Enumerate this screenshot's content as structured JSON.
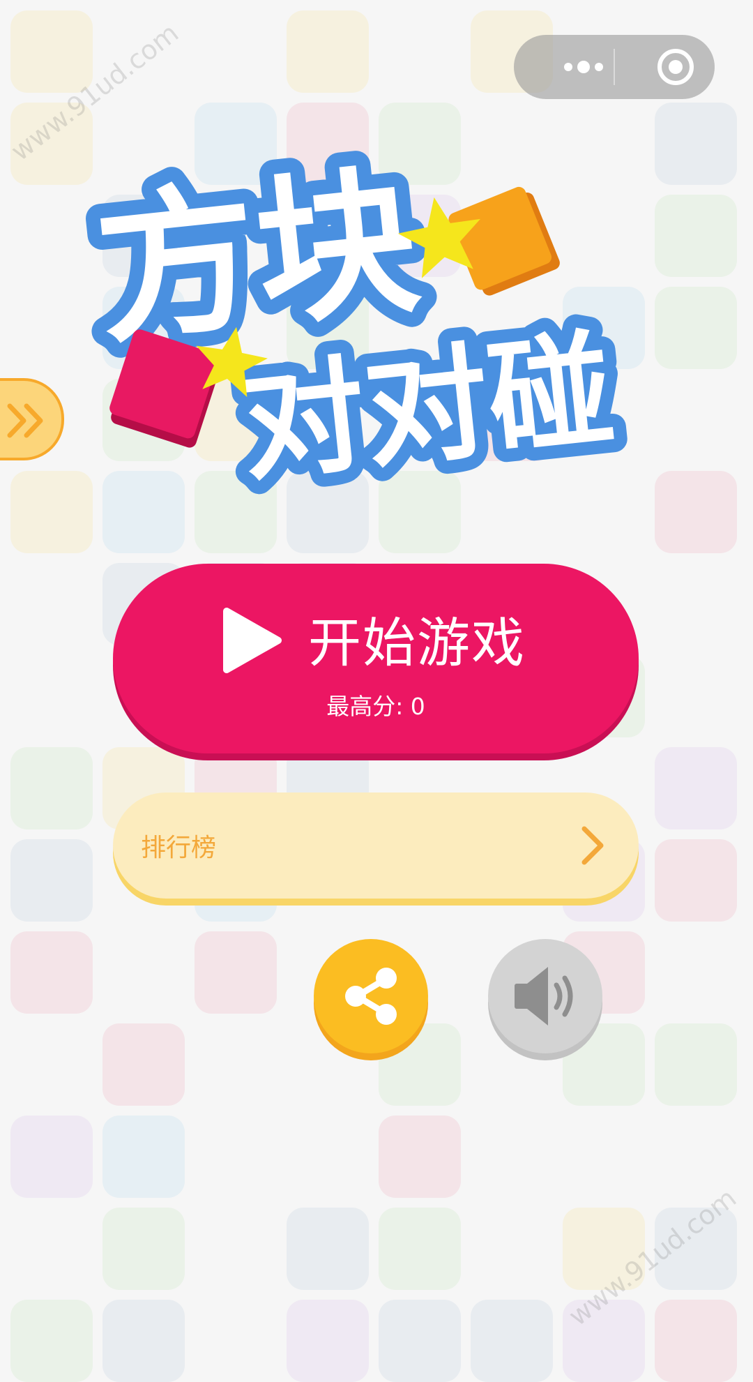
{
  "watermark": {
    "text": "www.91ud.com"
  },
  "logo": {
    "line1": "方块",
    "line2": "对对碰"
  },
  "menu": {
    "start_label": "开始游戏",
    "best_score_label": "最高分: 0",
    "ranking_label": "排行榜"
  },
  "colors": {
    "start_button": "#ec1663",
    "ranking_button": "#fcecbe",
    "ranking_text": "#f3a83a",
    "share_button": "#fbbd22",
    "sound_button": "#d3d3d3",
    "logo_outline": "#4a90e0"
  },
  "icons": {
    "capsule_more": "more-dots-icon",
    "capsule_close": "target-icon",
    "side_tab": "double-chevron-right-icon",
    "play": "play-icon",
    "ranking": "chevron-right-icon",
    "share": "share-icon",
    "sound": "speaker-icon"
  }
}
